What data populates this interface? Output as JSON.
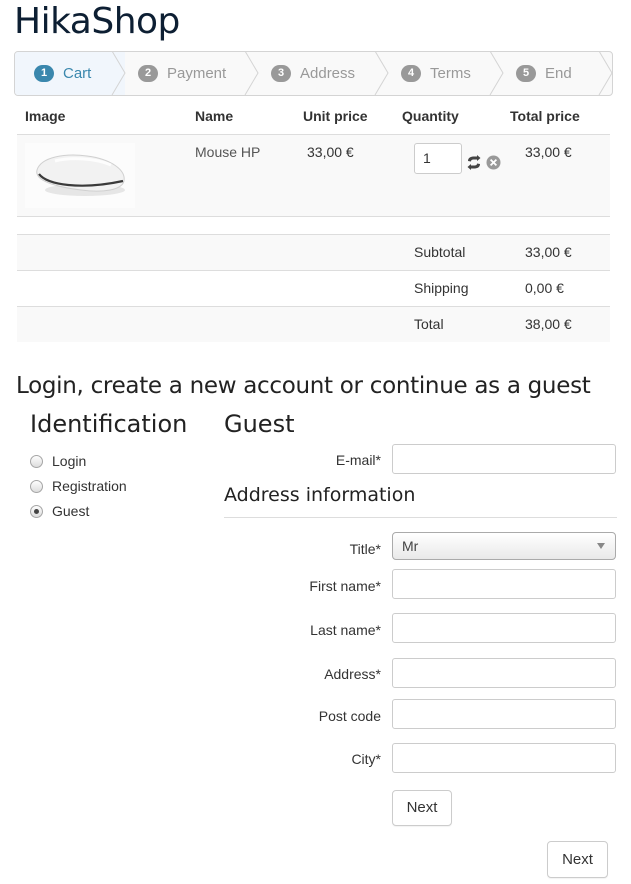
{
  "site": {
    "title": "HikaShop"
  },
  "steps": [
    {
      "num": "1",
      "label": "Cart"
    },
    {
      "num": "2",
      "label": "Payment"
    },
    {
      "num": "3",
      "label": "Address"
    },
    {
      "num": "4",
      "label": "Terms"
    },
    {
      "num": "5",
      "label": "End"
    }
  ],
  "cart": {
    "headers": {
      "image": "Image",
      "name": "Name",
      "unit_price": "Unit price",
      "quantity": "Quantity",
      "total_price": "Total price"
    },
    "items": [
      {
        "name": "Mouse HP",
        "unit_price": "33,00 €",
        "quantity": "1",
        "total_price": "33,00 €"
      }
    ],
    "summary": {
      "subtotal_label": "Subtotal",
      "subtotal": "33,00 €",
      "shipping_label": "Shipping",
      "shipping": "0,00 €",
      "total_label": "Total",
      "total": "38,00 €"
    }
  },
  "login": {
    "title": "Login, create a new account or continue as a guest",
    "identification_title": "Identification",
    "options": [
      {
        "label": "Login",
        "checked": false
      },
      {
        "label": "Registration",
        "checked": false
      },
      {
        "label": "Guest",
        "checked": true
      }
    ]
  },
  "guest": {
    "title": "Guest",
    "email_label": "E-mail*",
    "address_title": "Address information",
    "title_label": "Title*",
    "title_value": "Mr",
    "first_name_label": "First name*",
    "last_name_label": "Last name*",
    "address_label": "Address*",
    "postcode_label": "Post code",
    "city_label": "City*",
    "next_button": "Next"
  },
  "footer": {
    "next_button": "Next"
  },
  "colors": {
    "accent": "#3a87ad",
    "step_inactive": "#999999",
    "title": "#0d1f33"
  }
}
